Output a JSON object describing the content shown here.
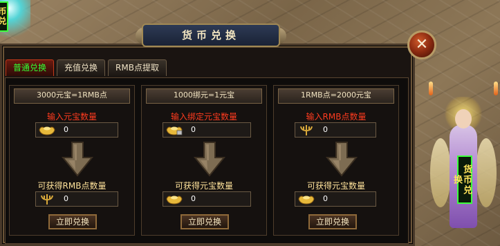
{
  "window": {
    "title": "货币兑换",
    "close_label": "✕"
  },
  "side_labels": {
    "left": "币兑",
    "right": "货币兑换"
  },
  "tabs": [
    {
      "label": "普通兑换",
      "active": true
    },
    {
      "label": "充值兑换",
      "active": false
    },
    {
      "label": "RMB点提取",
      "active": false
    }
  ],
  "columns": [
    {
      "rate": "3000元宝=1RMB点",
      "input_label": "输入元宝数量",
      "input_icon": "gold-ingot-icon",
      "input_value": "0",
      "output_label": "可获得RMB点数量",
      "output_icon": "trident-icon",
      "output_value": "0",
      "button": "立即兑换"
    },
    {
      "rate": "1000绑元=1元宝",
      "input_label": "输入绑定元宝数量",
      "input_icon": "bound-ingot-icon",
      "input_value": "0",
      "output_label": "可获得元宝数量",
      "output_icon": "gold-ingot-icon",
      "output_value": "0",
      "button": "立即兑换"
    },
    {
      "rate": "1RMB点=2000元宝",
      "input_label": "输入RMB点数量",
      "input_icon": "trident-icon",
      "input_value": "0",
      "output_label": "可获得元宝数量",
      "output_icon": "gold-ingot-icon",
      "output_value": "0",
      "button": "立即兑换"
    }
  ],
  "colors": {
    "label_red": "#ff3b1f",
    "label_gold": "#ffe39b",
    "active_tab_text": "#33ff33"
  }
}
